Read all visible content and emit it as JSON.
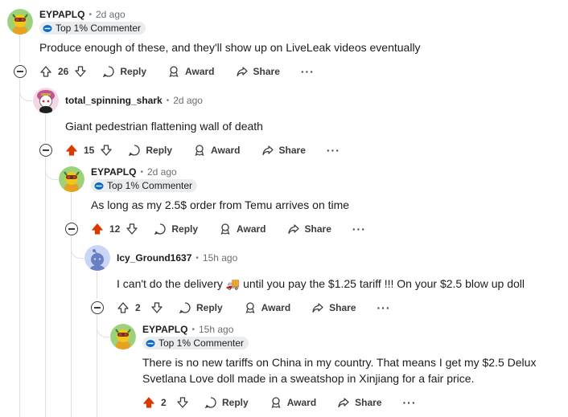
{
  "comments": [
    {
      "username": "EYPAPLQ",
      "time": "2d ago",
      "flair": "Top 1% Commenter",
      "lines": [
        "Produce enough of these, and they'll show up on LiveLeak videos eventually"
      ],
      "votes": "26",
      "upvoted": false,
      "avatar": "snoo-goggles"
    },
    {
      "username": "total_spinning_shark",
      "time": "2d ago",
      "flair": "",
      "lines": [
        "Giant pedestrian flattening wall of death"
      ],
      "votes": "15",
      "upvoted": true,
      "avatar": "snoo-pink-hair"
    },
    {
      "username": "EYPAPLQ",
      "time": "2d ago",
      "flair": "Top 1% Commenter",
      "lines": [
        "As long as my 2.5$ order from Temu arrives on time"
      ],
      "votes": "12",
      "upvoted": true,
      "avatar": "snoo-goggles"
    },
    {
      "username": "Icy_Ground1637",
      "time": "15h ago",
      "flair": "",
      "lines": [
        "I can't do the delivery 🚚 until you pay the $1.25 tariff !!! On your $2.5 blow up doll"
      ],
      "votes": "2",
      "upvoted": false,
      "avatar": "snoo-default-blue"
    },
    {
      "username": "EYPAPLQ",
      "time": "15h ago",
      "flair": "Top 1% Commenter",
      "lines": [
        "There is no new tariffs on China in my country. That means I get my $2.5 Delux",
        "Svetlana Love doll made in a sweatshop in Xinjiang for a fair price."
      ],
      "votes": "2",
      "upvoted": true,
      "avatar": "snoo-goggles"
    }
  ],
  "actions": {
    "reply": "Reply",
    "award": "Award",
    "share": "Share",
    "more": "···"
  },
  "colors": {
    "upvote_active": "#d93a00",
    "rail": "#e0e0e0",
    "flair_bg": "#eaedef",
    "text": "#1c1c1c",
    "meta": "#6a6f72"
  }
}
